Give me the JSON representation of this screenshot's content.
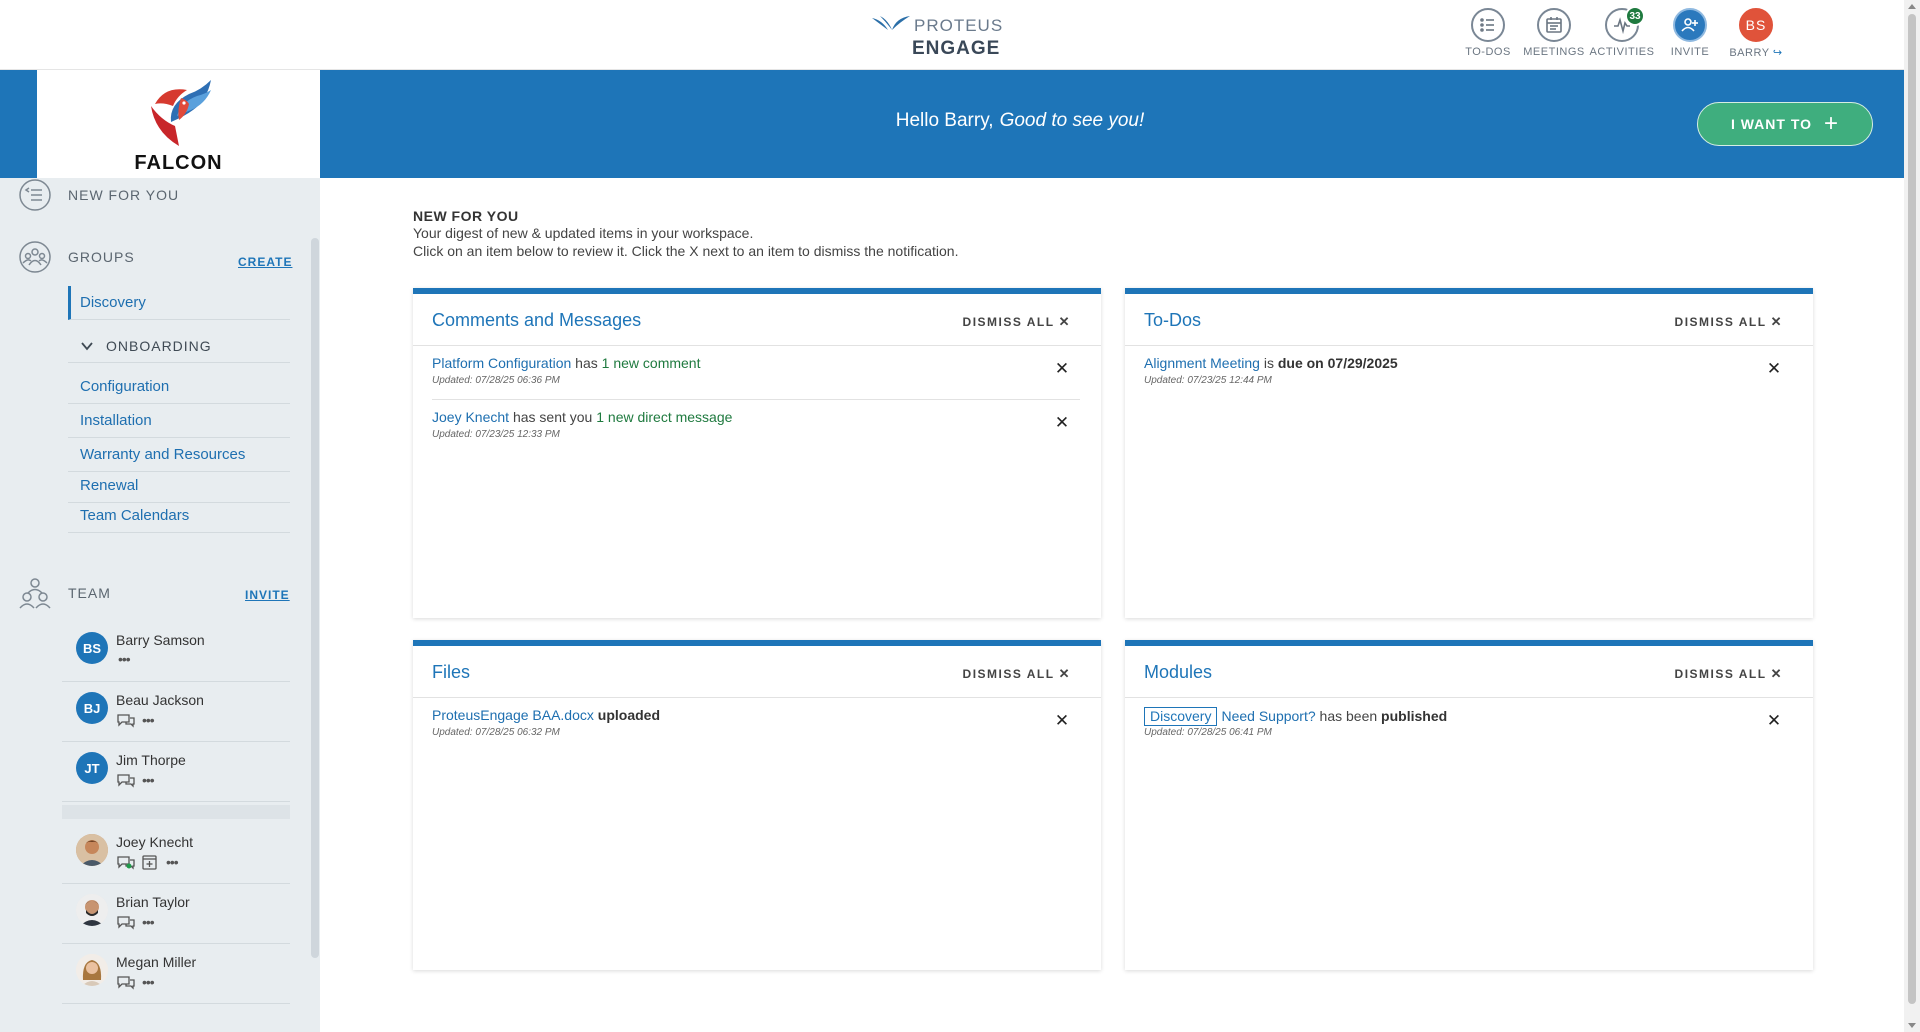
{
  "brand": {
    "proteus": "PROTEUS",
    "engage": "ENGAGE"
  },
  "topnav": [
    {
      "label": "TO-DOS",
      "icon": "list-icon"
    },
    {
      "label": "MEETINGS",
      "icon": "calendar-icon"
    },
    {
      "label": "ACTIVITIES",
      "icon": "activity-icon",
      "badge": "33"
    },
    {
      "label": "INVITE",
      "icon": "add-user-icon"
    },
    {
      "label": "BARRY",
      "icon": "avatar",
      "initials": "BS"
    }
  ],
  "workspace": {
    "name": "FALCON"
  },
  "banner": {
    "hello": "Hello Barry,",
    "sub": "Good to see you!",
    "cta": "I WANT TO"
  },
  "sidebar": {
    "new_for_you": "NEW FOR YOU",
    "groups_title": "GROUPS",
    "groups_action": "CREATE",
    "discovery": "Discovery",
    "onboarding": "ONBOARDING",
    "links": [
      "Configuration",
      "Installation",
      "Warranty and Resources",
      "Renewal",
      "Team Calendars"
    ],
    "team_title": "TEAM",
    "team_action": "INVITE",
    "members": [
      {
        "name": "Barry Samson",
        "initials": "BS"
      },
      {
        "name": "Beau Jackson",
        "initials": "BJ"
      },
      {
        "name": "Jim Thorpe",
        "initials": "JT"
      },
      {
        "name": "Joey Knecht"
      },
      {
        "name": "Brian Taylor"
      },
      {
        "name": "Megan Miller"
      }
    ]
  },
  "intro": {
    "title": "NEW FOR YOU",
    "line1": "Your digest of new & updated items in your workspace.",
    "line2": "Click on an item below to review it. Click the X next to an item to dismiss the notification."
  },
  "dismiss_all": "DISMISS ALL",
  "cards": {
    "comments": {
      "title": "Comments and Messages",
      "items": [
        {
          "link": "Platform Configuration",
          "mid": " has ",
          "green": "1 new comment",
          "updated": "Updated: 07/28/25 06:36 PM"
        },
        {
          "link": "Joey Knecht",
          "mid": " has sent you ",
          "green": "1 new direct message",
          "updated": "Updated: 07/23/25 12:33 PM"
        }
      ]
    },
    "todos": {
      "title": "To-Dos",
      "items": [
        {
          "link": "Alignment Meeting",
          "mid": " is ",
          "bold": "due on 07/29/2025",
          "updated": "Updated: 07/23/25 12:44 PM"
        }
      ]
    },
    "files": {
      "title": "Files",
      "items": [
        {
          "link": "ProteusEngage BAA.docx",
          "bold": " uploaded",
          "updated": "Updated: 07/28/25 06:32 PM"
        }
      ]
    },
    "modules": {
      "title": "Modules",
      "items": [
        {
          "tag": "Discovery",
          "link": "Need Support?",
          "mid": " has been ",
          "bold": "published",
          "updated": "Updated: 07/28/25 06:41 PM"
        }
      ]
    }
  },
  "colors": {
    "primary": "#1e75b8",
    "cta": "#3fae7e",
    "badge": "#1f7a3f",
    "avatar": "#e0533a"
  }
}
